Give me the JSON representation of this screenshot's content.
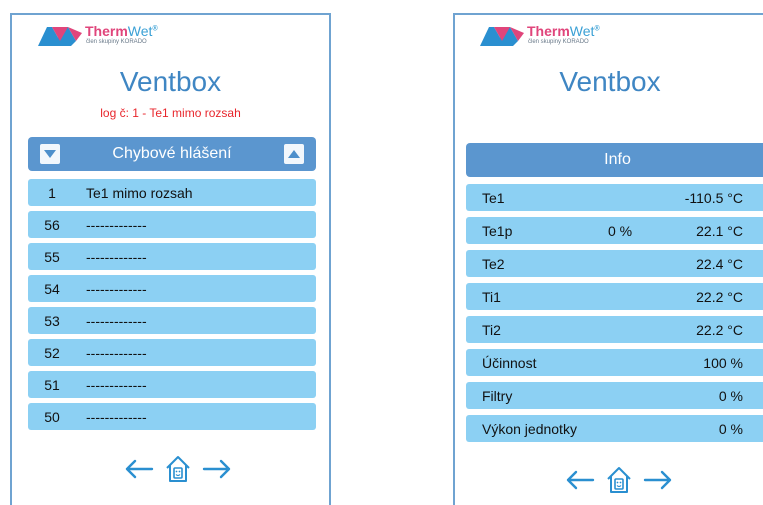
{
  "brand": {
    "name_part1": "Therm",
    "name_part2": "Wet",
    "registered": "®",
    "subtitle": "člen skupiny KORADO"
  },
  "colors": {
    "accent": "#3f86c3",
    "header_bar": "#5b96cf",
    "row": "#8cd0f3",
    "error_text": "#e8262c",
    "border": "#6fa3d1"
  },
  "left_panel": {
    "title": "Ventbox",
    "log_message": "log č: 1 - Te1 mimo rozsah",
    "list_header": "Chybové hlášení",
    "rows": [
      {
        "num": "1",
        "text": "Te1 mimo rozsah"
      },
      {
        "num": "56",
        "text": "-------------"
      },
      {
        "num": "55",
        "text": "-------------"
      },
      {
        "num": "54",
        "text": "-------------"
      },
      {
        "num": "53",
        "text": "-------------"
      },
      {
        "num": "52",
        "text": "-------------"
      },
      {
        "num": "51",
        "text": "-------------"
      },
      {
        "num": "50",
        "text": "-------------"
      }
    ]
  },
  "right_panel": {
    "title": "Ventbox",
    "info_header": "Info",
    "rows": [
      {
        "label": "Te1",
        "mid": "",
        "value": "-110.5 °C"
      },
      {
        "label": "Te1p",
        "mid": "0 %",
        "value": "22.1 °C"
      },
      {
        "label": "Te2",
        "mid": "",
        "value": "22.4 °C"
      },
      {
        "label": "Ti1",
        "mid": "",
        "value": "22.2 °C"
      },
      {
        "label": "Ti2",
        "mid": "",
        "value": "22.2 °C"
      },
      {
        "label": "Účinnost",
        "mid": "",
        "value": "100 %"
      },
      {
        "label": "Filtry",
        "mid": "",
        "value": "0 %"
      },
      {
        "label": "Výkon jednotky",
        "mid": "",
        "value": "0 %"
      }
    ]
  },
  "icons": {
    "nav_left": "arrow-left-icon",
    "nav_home": "house-face-icon",
    "nav_right": "arrow-right-icon",
    "scroll_down": "triangle-down-icon",
    "scroll_up": "triangle-up-icon"
  }
}
